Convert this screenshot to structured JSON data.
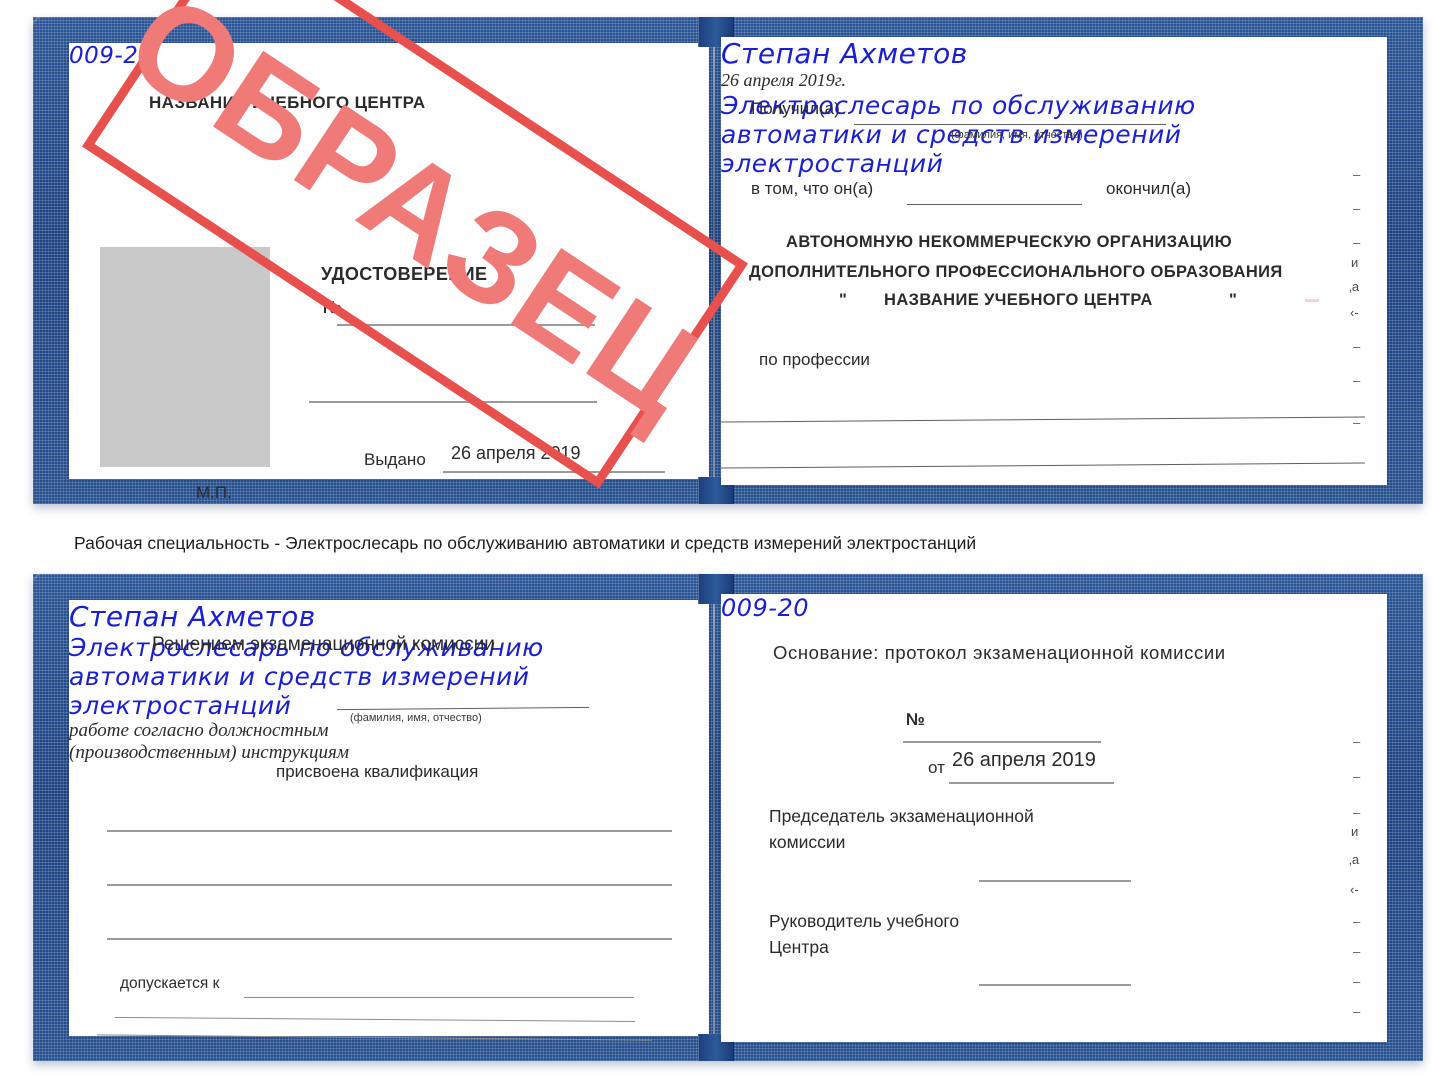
{
  "document": {
    "type": "certificate-scan",
    "caption": "Рабочая специальность - Электрослесарь по обслуживанию автоматики и средств измерений электростанций",
    "watermark": {
      "text": "ОБРАЗЕЦ",
      "color": "#ef7a78",
      "frame_color": "#e8504e"
    },
    "cover_color": "#1d4282"
  },
  "certificate_top": {
    "left_page": {
      "center_name": "НАЗВАНИЕ УЧЕБНОГО ЦЕНТРА",
      "title": "УДОСТОВЕРЕНИЕ",
      "number_label": "№",
      "number_value": "009-20",
      "issued_label": "Выдано",
      "issued_value": "26 апреля 2019",
      "seal_label": "М.П.",
      "photo_placeholder": "photo-area"
    },
    "right_page": {
      "received_label": "Получил(а)",
      "received_value": "Степан Ахметов",
      "fio_hint": "(фамилия, имя, отчество)",
      "in_that_label": "в том, что он(а)",
      "in_that_value": "26 апреля 2019г.",
      "finished_label": "окончил(а)",
      "org_line1": "АВТОНОМНУЮ НЕКОММЕРЧЕСКУЮ ОРГАНИЗАЦИЮ",
      "org_line2": "ДОПОЛНИТЕЛЬНОГО ПРОФЕССИОНАЛЬНОГО ОБРАЗОВАНИЯ",
      "org_line3_quote_open": "\"",
      "org_line3": "НАЗВАНИЕ УЧЕБНОГО ЦЕНТРА",
      "org_line3_quote_close": "\"",
      "profession_label": "по профессии",
      "profession_line1": "Электрослесарь по обслуживанию",
      "profession_line2": "автоматики и средств измерений",
      "profession_line3": "электростанций",
      "edge_fragments": [
        "–",
        "–",
        "–",
        "и",
        ",а",
        "‹-",
        "–",
        "–",
        "–"
      ]
    }
  },
  "certificate_bottom": {
    "left_page": {
      "heading": "Решением экзаменационной комиссии",
      "name_value": "Степан Ахметов",
      "fio_hint": "(фамилия, имя, отчество)",
      "qualification_label": "присвоена квалификация",
      "qualification_line1": "Электрослесарь по обслуживанию",
      "qualification_line2": "автоматики и средств измерений",
      "qualification_line3": "электростанций",
      "admitted_label": "допускается к",
      "admitted_value_line1": "работе согласно должностным",
      "admitted_value_line2": "(производственным) инструкциям"
    },
    "right_page": {
      "basis_label": "Основание: протокол экзаменационной комиссии",
      "number_label": "№",
      "number_value": "009-20",
      "date_label": "от",
      "date_value": "26 апреля 2019",
      "chairman_line1": "Председатель экзаменационной",
      "chairman_line2": "комиссии",
      "head_line1": "Руководитель учебного",
      "head_line2": "Центра",
      "edge_fragments": [
        "–",
        "–",
        "–",
        "и",
        ",а",
        "‹-",
        "–",
        "–",
        "–",
        "–"
      ]
    }
  }
}
